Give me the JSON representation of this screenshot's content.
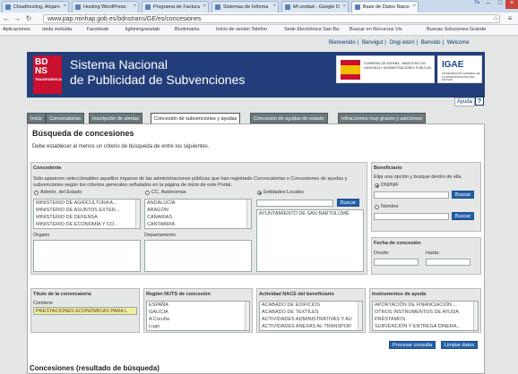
{
  "browser": {
    "tabs": [
      {
        "label": "Cloudhosting, Alojam"
      },
      {
        "label": "Hosting WordPress:"
      },
      {
        "label": "Programa de Factura"
      },
      {
        "label": "Sistemas de Informa"
      },
      {
        "label": "Mi unidad - Google D"
      },
      {
        "label": "Base de Datos Nacio"
      }
    ],
    "user": "Ta",
    "url": "www.pap.minhap.gob.es/bdnstrans/GE/es/concesiones",
    "bookmarks": [
      "Aplicaciones",
      "onda melodia",
      "Facebook",
      "lightningnewtab",
      "Bookmarks",
      "Inicio de sesión Telefon",
      "Sede Electrónica San Ba",
      "Buscar en Recursos Vis",
      "Buscas Soluciones Grande"
    ]
  },
  "site": {
    "top_links": [
      "Bienvenido",
      "Benvigut",
      "Ongi etorri",
      "Benvido",
      "Welcome"
    ],
    "logo": "BDNS",
    "logo_sub": "TRANSPARENCIA",
    "title_line1": "Sistema Nacional",
    "title_line2": "de Publicidad de Subvenciones",
    "gov_text": "GOBIERNO DE ESPAÑA · MINISTERIO DE HACIENDA Y ADMINISTRACIONES PÚBLICAS",
    "igae": "IGAE",
    "igae_sub": "INTERVENCIÓN GENERAL DE LA ADMINISTRACIÓN DEL ESTADO",
    "help": "Ayuda",
    "help_q": "?"
  },
  "tabs": [
    "Inicio",
    "Convocatorias",
    "Inscripción de alertas",
    "Concesión de subvenciones y ayudas",
    "Concesión de ayudas de estado",
    "Infracciones muy graves y sanciones"
  ],
  "search": {
    "title": "Búsqueda de concesiones",
    "message": "Debe establecer al menos un criterio de búsqueda de entre los siguientes.",
    "concedente": {
      "title": "Concedente",
      "info_line1": "Sólo aparecen seleccionables aquellos órganos de las administraciones públicas que han registrado Convocatorias o Concesiones de ayudas y",
      "info_line2": "subvenciones según los criterios generales señalados en la página de inicio de este Portal.",
      "radio_estado": "Admón. del Estado",
      "radio_autonomas": "CC. Autónomas",
      "radio_locales": "Entidades Locales",
      "estado_list": [
        "MINISTERIO DE AGRICULTURA A...",
        "MINISTERIO DE ASUNTOS EXTER...",
        "MINISTERIO DE DEFENSA",
        "MINISTERIO DE ECONOMÍA Y CO..."
      ],
      "autonomas_list": [
        "ANDALUCÍA",
        "ARAGÓN",
        "CANARIAS",
        "CANTABRIA"
      ],
      "search_btn": "Buscar",
      "locales_list": [
        "AYUNTAMIENTO DE SAN BARTOLOMÉ"
      ],
      "organo_label": "Órgano",
      "departamento_label": "Departamento"
    },
    "beneficiario": {
      "title": "Beneficiario",
      "hint": "Elija una opción y busque dentro de ella",
      "radio_dni": "DNI/NIF",
      "radio_nombre": "Nombre",
      "search_btn": "Buscar"
    },
    "fecha": {
      "title": "Fecha de concesión",
      "desde": "Desde:",
      "hasta": "Hasta:"
    },
    "titulo": {
      "title": "Título de la convocatoria",
      "contiene": "Contiene",
      "value": "PRESTACIONES ECONÓMICAS PARA L"
    },
    "region": {
      "title": "Región NUTS de concesión",
      "items": [
        "ESPAÑA",
        "GALICIA",
        "A Coruña",
        "Lugo"
      ]
    },
    "actividad": {
      "title": "Actividad NACE del beneficiario",
      "items": [
        "ACABADO DE EDIFICIOS",
        "ACABADO DE TEXTILES",
        "ACTIVIDADES ADMINISTRATIVAS Y AU",
        "ACTIVIDADES ANEXAS AL TRANSPOR"
      ]
    },
    "instrumentos": {
      "title": "Instrumentos de ayuda",
      "items": [
        "APORTACIÓN DE FINANCIACIÓN ...",
        "OTROS INSTRUMENTOS DE AYUDA",
        "PRÉSTAMOS",
        "SUBVENCIÓN Y ENTREGA DINERA..."
      ]
    },
    "process_btn": "Procesar consulta",
    "clear_btn": "Limpiar datos"
  },
  "results": {
    "title": "Concesiones (resultado de búsqueda)"
  }
}
